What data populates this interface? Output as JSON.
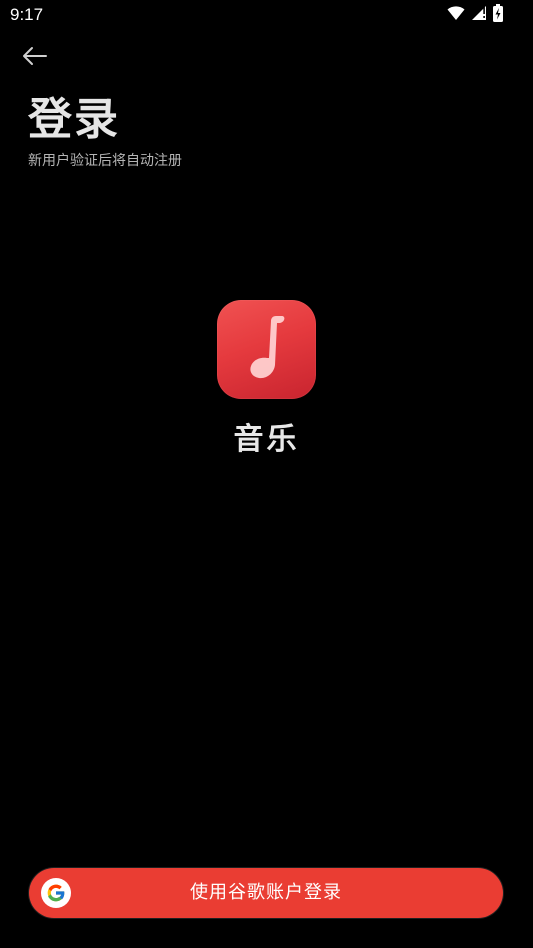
{
  "status_bar": {
    "time": "9:17",
    "icons": [
      "wifi-icon",
      "signal-icon",
      "battery-icon"
    ]
  },
  "header": {
    "back_icon": "arrow-left-icon",
    "title": "登录",
    "subtitle": "新用户验证后将自动注册"
  },
  "app": {
    "icon": "music-note-icon",
    "name": "音乐"
  },
  "login": {
    "google_button_label": "使用谷歌账户登录",
    "google_icon": "google-g-icon"
  },
  "colors": {
    "background": "#000000",
    "accent": "#ea3d33",
    "app_icon_red": "#e53a3e"
  }
}
